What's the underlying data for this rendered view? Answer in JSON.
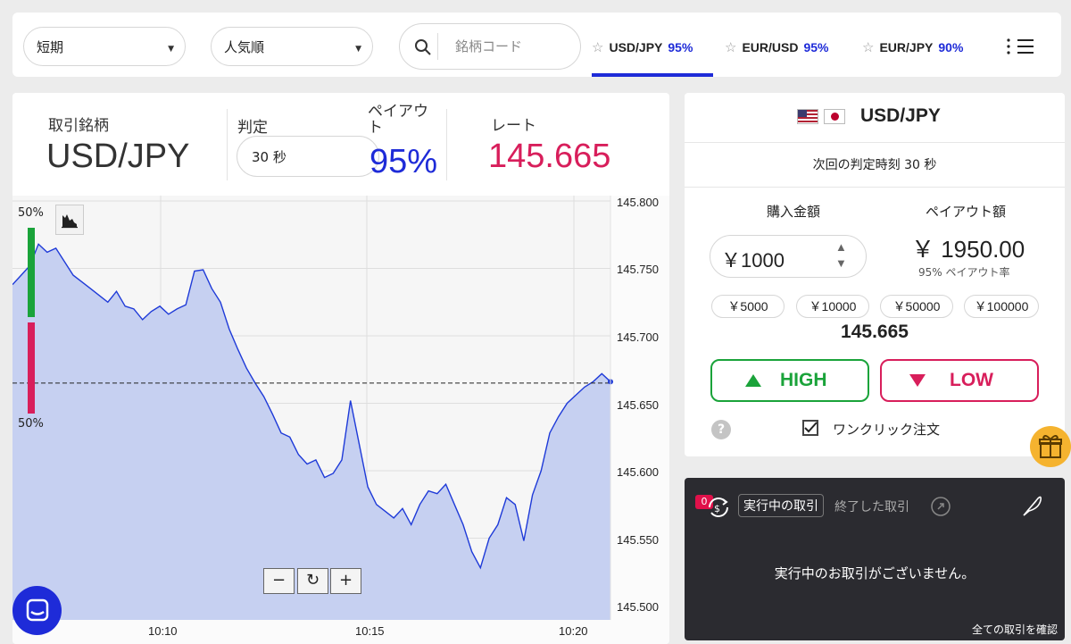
{
  "topbar": {
    "filter_select": "短期",
    "sort_select": "人気順",
    "search_placeholder": "銘柄コード",
    "favorites": [
      {
        "name": "USD/JPY",
        "pct": "95%"
      },
      {
        "name": "EUR/USD",
        "pct": "95%"
      },
      {
        "name": "EUR/JPY",
        "pct": "90%"
      }
    ]
  },
  "info": {
    "pair_label": "取引銘柄",
    "pair": "USD/JPY",
    "judge_label": "判定",
    "judge_value": "30 秒",
    "payout_label": "ペイアウト",
    "payout_value": "95%",
    "rate_label": "レート",
    "rate_value": "145.665"
  },
  "chart_data": {
    "type": "area",
    "y_ticks": [
      "145.800",
      "145.750",
      "145.700",
      "145.650",
      "145.600",
      "145.550",
      "145.500"
    ],
    "ylim": [
      145.5,
      145.8
    ],
    "x_ticks": [
      "10:10",
      "10:15",
      "10:20"
    ],
    "current_rate": 145.665,
    "high_pct": "50%",
    "low_pct": "50%",
    "series": [
      {
        "values": [
          145.738,
          145.745,
          145.752,
          145.768,
          145.762,
          145.765,
          145.755,
          145.745,
          145.74,
          145.735,
          145.73,
          145.725,
          145.733,
          145.722,
          145.72,
          145.712,
          145.718,
          145.722,
          145.716,
          145.72,
          145.723,
          145.748,
          145.749,
          145.735,
          145.725,
          145.705,
          145.69,
          145.676,
          145.665,
          145.655,
          145.642,
          145.628,
          145.625,
          145.612,
          145.605,
          145.608,
          145.595,
          145.598,
          145.608,
          145.652,
          145.62,
          145.588,
          145.575,
          145.57,
          145.565,
          145.572,
          145.56,
          145.575,
          145.585,
          145.583,
          145.59,
          145.575,
          145.56,
          145.54,
          145.528,
          145.55,
          145.56,
          145.58,
          145.575,
          145.548,
          145.582,
          145.6,
          145.628,
          145.64,
          145.65,
          145.656,
          145.662,
          145.666,
          145.672,
          145.666
        ]
      }
    ]
  },
  "chart_controls": {
    "zoom_out": "−",
    "reset": "↻",
    "zoom_in": "+"
  },
  "trade": {
    "pair": "USD/JPY",
    "next_judge": "次回の判定時刻 30 秒",
    "buy_label": "購入金額",
    "payout_label": "ペイアウト額",
    "amount": "￥1000",
    "payout_amount": "￥ 1950.00",
    "payout_rate_text": "95% ペイアウト率",
    "chips": [
      "￥5000",
      "￥10000",
      "￥50000",
      "￥100000"
    ],
    "rate": "145.665",
    "high": "HIGH",
    "low": "LOW",
    "one_click": "ワンクリック注文",
    "help": "?",
    "colors": {
      "high": "#1aa33a",
      "low": "#d81e5b",
      "accent": "#1e2bd8"
    }
  },
  "trades": {
    "badge": "0",
    "tab_active": "実行中の取引",
    "tab_inactive": "終了した取引",
    "empty": "実行中のお取引がございません。",
    "view_all": "全ての取引を確認"
  }
}
